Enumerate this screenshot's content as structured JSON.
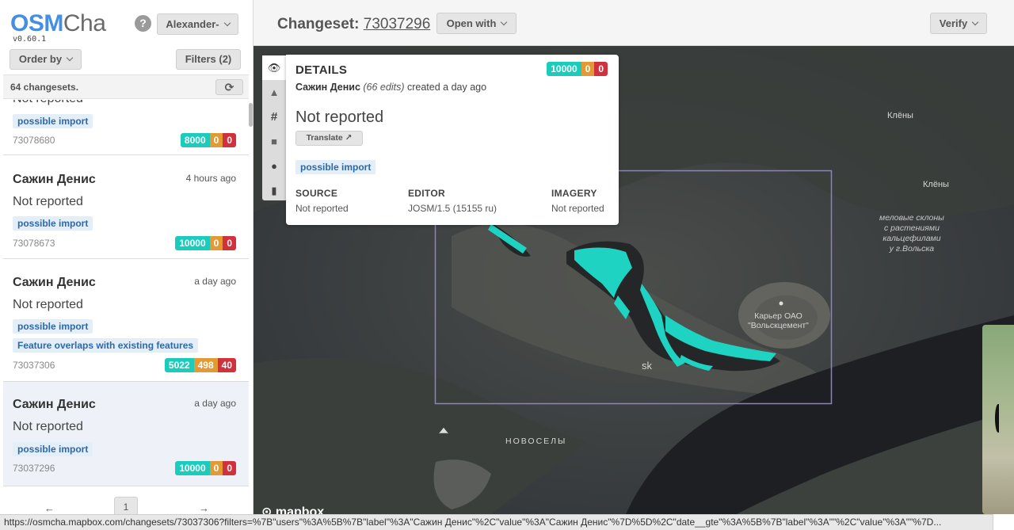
{
  "brand": {
    "part1": "OSM",
    "part2": "Cha",
    "version": "v0.60.1"
  },
  "sidebar": {
    "help_label": "?",
    "user_button": "Alexander-",
    "order_button": "Order by",
    "filters_button": "Filters (2)",
    "count_text": "64 changesets.",
    "refresh_label": "⟳",
    "items": [
      {
        "title": "",
        "time": "",
        "status": "Not reported",
        "tags": [
          "possible import"
        ],
        "id": "73078680",
        "counts": [
          "8000",
          "0",
          "0"
        ]
      },
      {
        "title": "Сажин Денис",
        "time": "4 hours ago",
        "status": "Not reported",
        "tags": [
          "possible import"
        ],
        "id": "73078673",
        "counts": [
          "10000",
          "0",
          "0"
        ]
      },
      {
        "title": "Сажин Денис",
        "time": "a day ago",
        "status": "Not reported",
        "tags": [
          "possible import",
          "Feature overlaps with existing features"
        ],
        "id": "73037306",
        "counts": [
          "5022",
          "498",
          "40"
        ]
      },
      {
        "title": "Сажин Денис",
        "time": "a day ago",
        "status": "Not reported",
        "tags": [
          "possible import"
        ],
        "id": "73037296",
        "counts": [
          "10000",
          "0",
          "0"
        ],
        "selected": true
      }
    ],
    "pager": {
      "prev": "←",
      "page": "1",
      "next": "→"
    }
  },
  "header": {
    "label": "Changeset:",
    "changeset_id": "73037296",
    "open_with": "Open with",
    "verify": "Verify"
  },
  "details": {
    "title": "DETAILS",
    "counts": [
      "10000",
      "0",
      "0"
    ],
    "user": "Сажин Денис",
    "edits": "(66 edits)",
    "created": "created a day ago",
    "status": "Not reported",
    "translate": "Translate",
    "tag": "possible import",
    "source_label": "SOURCE",
    "source_value": "Not reported",
    "editor_label": "EDITOR",
    "editor_value": "JOSM/1.5 (15155 ru)",
    "imagery_label": "IMAGERY",
    "imagery_value": "Not reported"
  },
  "tools": [
    "eye-icon",
    "warning-icon",
    "hash-icon",
    "comment-icon",
    "user-icon",
    "map-icon"
  ],
  "map": {
    "labels": {
      "klyony1": "Клёны",
      "klyony2": "Клёны",
      "slopes": "меловые склоны\nс растениями\nкальцефилами\nу г.Вольска",
      "quarry": "Карьер ОАО\n\"Вольскцемент\"",
      "city": "sk",
      "novosely": "НОВОСЕЛЫ"
    },
    "attribution": "mapbox",
    "colors": {
      "edits": "#1fd3c2",
      "bbox": "#8f7fd0"
    }
  },
  "statusbar": {
    "url": "https://osmcha.mapbox.com/changesets/73037306?filters=%7B\"users\"%3A%5B%7B\"label\"%3A\"Сажин Денис\"%2C\"value\"%3A\"Сажин Денис\"%7D%5D%2C\"date__gte\"%3A%5B%7B\"label\"%3A\"\"%2C\"value\"%3A\"\"%7D..."
  }
}
